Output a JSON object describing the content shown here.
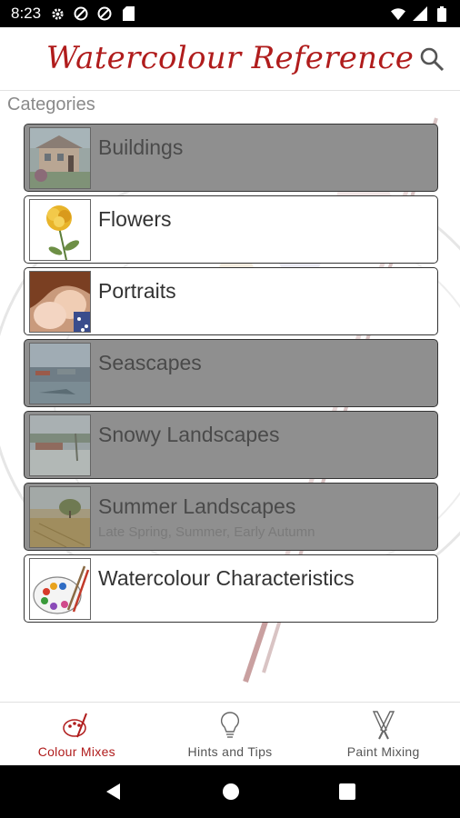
{
  "status_bar": {
    "time": "8:23",
    "left_icons": [
      "gear-icon",
      "blocked-icon",
      "blocked-icon",
      "sd-card-icon"
    ],
    "right_icons": [
      "wifi-icon",
      "signal-icon",
      "battery-icon"
    ]
  },
  "app_bar": {
    "title": "Watercolour Reference",
    "search_icon": "search-icon"
  },
  "content": {
    "section_label": "Categories",
    "categories": [
      {
        "title": "Buildings",
        "subtitle": "",
        "dimmed": true
      },
      {
        "title": "Flowers",
        "subtitle": "",
        "dimmed": false
      },
      {
        "title": "Portraits",
        "subtitle": "",
        "dimmed": false
      },
      {
        "title": "Seascapes",
        "subtitle": "",
        "dimmed": true
      },
      {
        "title": "Snowy Landscapes",
        "subtitle": "",
        "dimmed": true
      },
      {
        "title": "Summer Landscapes",
        "subtitle": "Late Spring, Summer, Early Autumn",
        "dimmed": true
      },
      {
        "title": "Watercolour Characteristics",
        "subtitle": "",
        "dimmed": false
      }
    ]
  },
  "bottom_nav": {
    "items": [
      {
        "label": "Colour Mixes",
        "icon": "palette-brush-icon",
        "active": true
      },
      {
        "label": "Hints and Tips",
        "icon": "lightbulb-icon",
        "active": false
      },
      {
        "label": "Paint Mixing",
        "icon": "crossed-knives-icon",
        "active": false
      }
    ]
  },
  "colors": {
    "accent": "#b01c1c",
    "dimmed_row": "#8f8f8f",
    "label_grey": "#8a8a8a"
  },
  "system_nav": {
    "buttons": [
      "back-icon",
      "home-icon",
      "recents-icon"
    ]
  }
}
